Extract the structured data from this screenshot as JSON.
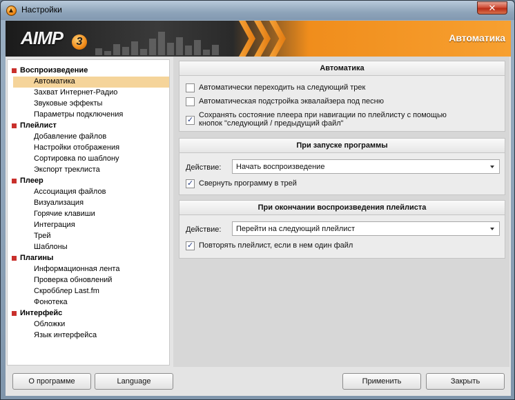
{
  "window": {
    "title": "Настройки",
    "close_symbol": "✕"
  },
  "banner": {
    "logo": "AIMP",
    "logo_version": "3",
    "title": "Автоматика"
  },
  "sidebar": {
    "groups": [
      {
        "label": "Воспроизведение",
        "items": [
          "Автоматика",
          "Захват Интернет-Радио",
          "Звуковые эффекты",
          "Параметры подключения"
        ]
      },
      {
        "label": "Плейлист",
        "items": [
          "Добавление файлов",
          "Настройки отображения",
          "Сортировка по шаблону",
          "Экспорт треклиста"
        ]
      },
      {
        "label": "Плеер",
        "items": [
          "Ассоциация файлов",
          "Визуализация",
          "Горячие клавиши",
          "Интеграция",
          "Трей",
          "Шаблоны"
        ]
      },
      {
        "label": "Плагины",
        "items": [
          "Информационная лента",
          "Проверка обновлений",
          "Скробблер Last.fm",
          "Фонотека"
        ]
      },
      {
        "label": "Интерфейс",
        "items": [
          "Обложки",
          "Язык интерфейса"
        ]
      }
    ],
    "selected": "Автоматика"
  },
  "sections": {
    "auto": {
      "title": "Автоматика",
      "options": [
        {
          "label": "Автоматически переходить на следующий трек",
          "checked": false
        },
        {
          "label": "Автоматическая подстройка эквалайзера под песню",
          "checked": false
        },
        {
          "label_line1": "Сохранять состояние плеера при навигации по плейлисту с помощью",
          "label_line2": "кнопок \"следующий / предыдущий файл\"",
          "checked": true
        }
      ]
    },
    "startup": {
      "title": "При запуске программы",
      "action_label": "Действие:",
      "action_value": "Начать воспроизведение",
      "option": {
        "label": "Свернуть программу в трей",
        "checked": true
      }
    },
    "playlist_end": {
      "title": "При окончании воспроизведения плейлиста",
      "action_label": "Действие:",
      "action_value": "Перейти на следующий плейлист",
      "option": {
        "label": "Повторять плейлист, если в нем один файл",
        "checked": true
      }
    }
  },
  "buttons": {
    "about": "О программе",
    "language": "Language",
    "apply": "Применить",
    "close": "Закрыть"
  },
  "colors": {
    "accent_orange": "#f08d1c",
    "selected_item": "#f5d49a",
    "tree_bullet": "#c9302c"
  }
}
